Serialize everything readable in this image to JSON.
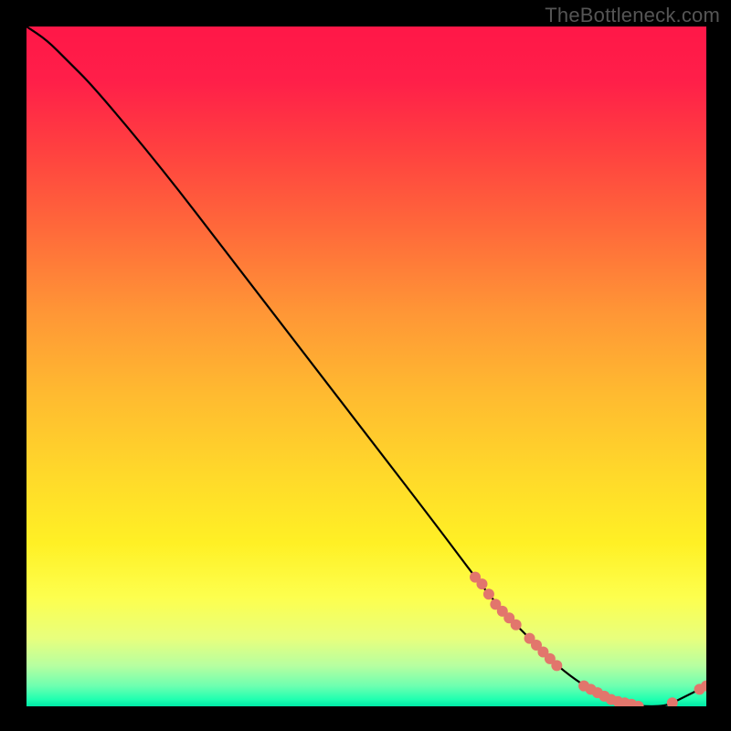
{
  "watermark": "TheBottleneck.com",
  "chart_data": {
    "type": "line",
    "title": "",
    "xlabel": "",
    "ylabel": "",
    "xlim": [
      0,
      100
    ],
    "ylim": [
      0,
      100
    ],
    "series": [
      {
        "name": "curve",
        "x": [
          0,
          3,
          6,
          10,
          20,
          30,
          40,
          50,
          60,
          66,
          70,
          74,
          78,
          82,
          86,
          90,
          94,
          96,
          100
        ],
        "values": [
          100,
          98,
          95,
          91,
          79,
          66,
          53,
          40,
          27,
          19,
          14,
          10,
          6,
          3,
          1,
          0,
          0,
          1,
          3
        ],
        "color": "#000000"
      }
    ],
    "markers": [
      {
        "x": 66,
        "y": 19
      },
      {
        "x": 67,
        "y": 18
      },
      {
        "x": 68,
        "y": 16.5
      },
      {
        "x": 69,
        "y": 15
      },
      {
        "x": 70,
        "y": 14
      },
      {
        "x": 71,
        "y": 13
      },
      {
        "x": 72,
        "y": 12
      },
      {
        "x": 74,
        "y": 10
      },
      {
        "x": 75,
        "y": 9
      },
      {
        "x": 76,
        "y": 8
      },
      {
        "x": 77,
        "y": 7
      },
      {
        "x": 78,
        "y": 6
      },
      {
        "x": 82,
        "y": 3
      },
      {
        "x": 83,
        "y": 2.5
      },
      {
        "x": 84,
        "y": 2
      },
      {
        "x": 85,
        "y": 1.5
      },
      {
        "x": 86,
        "y": 1
      },
      {
        "x": 87,
        "y": 0.7
      },
      {
        "x": 88,
        "y": 0.5
      },
      {
        "x": 89,
        "y": 0.3
      },
      {
        "x": 90,
        "y": 0
      },
      {
        "x": 95,
        "y": 0.5
      },
      {
        "x": 99,
        "y": 2.5
      },
      {
        "x": 100,
        "y": 3
      }
    ],
    "marker_color": "#e2766c",
    "marker_radius_px": 6
  }
}
